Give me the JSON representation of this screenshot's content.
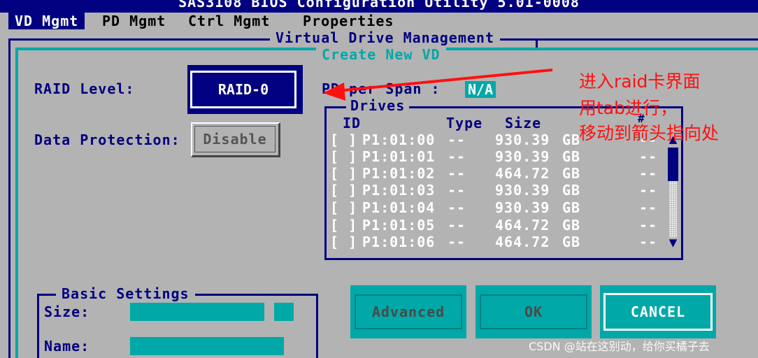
{
  "title": "SAS3108 BIOS Configuration Utility 5.01-0008",
  "menu": [
    {
      "label": "VD Mgmt",
      "active": true
    },
    {
      "label": "PD Mgmt"
    },
    {
      "label": "Ctrl Mgmt"
    },
    {
      "label": "Properties"
    }
  ],
  "frame_title": "Virtual Drive Management",
  "dialog_title": "Create New VD",
  "raid_level": {
    "label": "RAID Level:",
    "value": "RAID-0"
  },
  "data_protection": {
    "label": "Data Protection:",
    "value": "Disable"
  },
  "per_span": {
    "label": "PD per Span :",
    "value": "N/A"
  },
  "drives": {
    "title": "Drives",
    "columns": [
      "ID",
      "Type",
      "Size",
      "#"
    ],
    "rows": [
      {
        "check": "[ ]",
        "id": "P1:01:00",
        "type": "--",
        "size": "930.39",
        "unit": "GB",
        "num": "--"
      },
      {
        "check": "[ ]",
        "id": "P1:01:01",
        "type": "--",
        "size": "930.39",
        "unit": "GB",
        "num": "--"
      },
      {
        "check": "[ ]",
        "id": "P1:01:02",
        "type": "--",
        "size": "464.72",
        "unit": "GB",
        "num": "--"
      },
      {
        "check": "[ ]",
        "id": "P1:01:03",
        "type": "--",
        "size": "930.39",
        "unit": "GB",
        "num": "--"
      },
      {
        "check": "[ ]",
        "id": "P1:01:04",
        "type": "--",
        "size": "930.39",
        "unit": "GB",
        "num": "--"
      },
      {
        "check": "[ ]",
        "id": "P1:01:05",
        "type": "--",
        "size": "464.72",
        "unit": "GB",
        "num": "--"
      },
      {
        "check": "[ ]",
        "id": "P1:01:06",
        "type": "--",
        "size": "464.72",
        "unit": "GB",
        "num": "--"
      }
    ]
  },
  "basic_settings": {
    "title": "Basic Settings",
    "size_label": "Size:",
    "name_label": "Name:"
  },
  "buttons": {
    "advanced": "Advanced",
    "ok": "OK",
    "cancel": "CANCEL"
  },
  "annotation": [
    "进入raid卡界面",
    "用tab进行，",
    "移动到箭头指向处"
  ],
  "watermark": "CSDN @站在这别动，给你买橘子去",
  "colors": {
    "navy": "#000080",
    "teal": "#00a8a8",
    "gray": "#b3b3b3",
    "annotation_red": "#ff1010"
  },
  "icons": {
    "scroll_up": "triangle-up",
    "scroll_down": "triangle-down",
    "annotation_arrow": "arrow-left"
  }
}
